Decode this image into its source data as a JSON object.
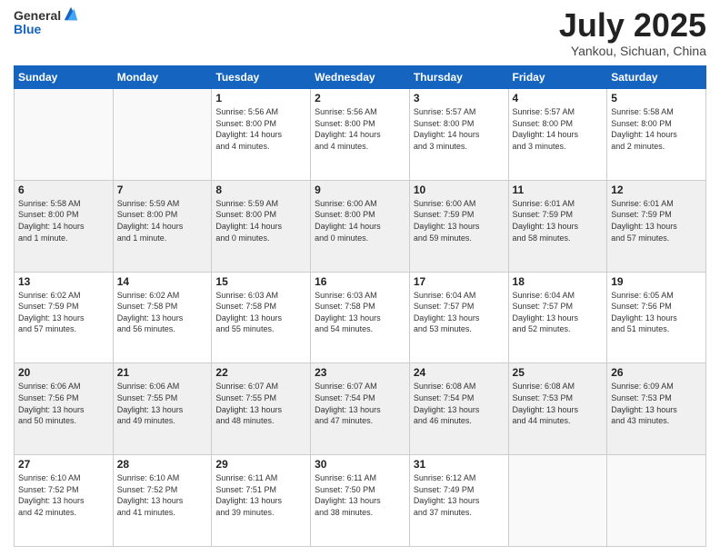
{
  "header": {
    "logo": {
      "general": "General",
      "blue": "Blue"
    },
    "title": "July 2025",
    "location": "Yankou, Sichuan, China"
  },
  "days_of_week": [
    "Sunday",
    "Monday",
    "Tuesday",
    "Wednesday",
    "Thursday",
    "Friday",
    "Saturday"
  ],
  "weeks": [
    [
      {
        "day": "",
        "info": ""
      },
      {
        "day": "",
        "info": ""
      },
      {
        "day": "1",
        "info": "Sunrise: 5:56 AM\nSunset: 8:00 PM\nDaylight: 14 hours\nand 4 minutes."
      },
      {
        "day": "2",
        "info": "Sunrise: 5:56 AM\nSunset: 8:00 PM\nDaylight: 14 hours\nand 4 minutes."
      },
      {
        "day": "3",
        "info": "Sunrise: 5:57 AM\nSunset: 8:00 PM\nDaylight: 14 hours\nand 3 minutes."
      },
      {
        "day": "4",
        "info": "Sunrise: 5:57 AM\nSunset: 8:00 PM\nDaylight: 14 hours\nand 3 minutes."
      },
      {
        "day": "5",
        "info": "Sunrise: 5:58 AM\nSunset: 8:00 PM\nDaylight: 14 hours\nand 2 minutes."
      }
    ],
    [
      {
        "day": "6",
        "info": "Sunrise: 5:58 AM\nSunset: 8:00 PM\nDaylight: 14 hours\nand 1 minute."
      },
      {
        "day": "7",
        "info": "Sunrise: 5:59 AM\nSunset: 8:00 PM\nDaylight: 14 hours\nand 1 minute."
      },
      {
        "day": "8",
        "info": "Sunrise: 5:59 AM\nSunset: 8:00 PM\nDaylight: 14 hours\nand 0 minutes."
      },
      {
        "day": "9",
        "info": "Sunrise: 6:00 AM\nSunset: 8:00 PM\nDaylight: 14 hours\nand 0 minutes."
      },
      {
        "day": "10",
        "info": "Sunrise: 6:00 AM\nSunset: 7:59 PM\nDaylight: 13 hours\nand 59 minutes."
      },
      {
        "day": "11",
        "info": "Sunrise: 6:01 AM\nSunset: 7:59 PM\nDaylight: 13 hours\nand 58 minutes."
      },
      {
        "day": "12",
        "info": "Sunrise: 6:01 AM\nSunset: 7:59 PM\nDaylight: 13 hours\nand 57 minutes."
      }
    ],
    [
      {
        "day": "13",
        "info": "Sunrise: 6:02 AM\nSunset: 7:59 PM\nDaylight: 13 hours\nand 57 minutes."
      },
      {
        "day": "14",
        "info": "Sunrise: 6:02 AM\nSunset: 7:58 PM\nDaylight: 13 hours\nand 56 minutes."
      },
      {
        "day": "15",
        "info": "Sunrise: 6:03 AM\nSunset: 7:58 PM\nDaylight: 13 hours\nand 55 minutes."
      },
      {
        "day": "16",
        "info": "Sunrise: 6:03 AM\nSunset: 7:58 PM\nDaylight: 13 hours\nand 54 minutes."
      },
      {
        "day": "17",
        "info": "Sunrise: 6:04 AM\nSunset: 7:57 PM\nDaylight: 13 hours\nand 53 minutes."
      },
      {
        "day": "18",
        "info": "Sunrise: 6:04 AM\nSunset: 7:57 PM\nDaylight: 13 hours\nand 52 minutes."
      },
      {
        "day": "19",
        "info": "Sunrise: 6:05 AM\nSunset: 7:56 PM\nDaylight: 13 hours\nand 51 minutes."
      }
    ],
    [
      {
        "day": "20",
        "info": "Sunrise: 6:06 AM\nSunset: 7:56 PM\nDaylight: 13 hours\nand 50 minutes."
      },
      {
        "day": "21",
        "info": "Sunrise: 6:06 AM\nSunset: 7:55 PM\nDaylight: 13 hours\nand 49 minutes."
      },
      {
        "day": "22",
        "info": "Sunrise: 6:07 AM\nSunset: 7:55 PM\nDaylight: 13 hours\nand 48 minutes."
      },
      {
        "day": "23",
        "info": "Sunrise: 6:07 AM\nSunset: 7:54 PM\nDaylight: 13 hours\nand 47 minutes."
      },
      {
        "day": "24",
        "info": "Sunrise: 6:08 AM\nSunset: 7:54 PM\nDaylight: 13 hours\nand 46 minutes."
      },
      {
        "day": "25",
        "info": "Sunrise: 6:08 AM\nSunset: 7:53 PM\nDaylight: 13 hours\nand 44 minutes."
      },
      {
        "day": "26",
        "info": "Sunrise: 6:09 AM\nSunset: 7:53 PM\nDaylight: 13 hours\nand 43 minutes."
      }
    ],
    [
      {
        "day": "27",
        "info": "Sunrise: 6:10 AM\nSunset: 7:52 PM\nDaylight: 13 hours\nand 42 minutes."
      },
      {
        "day": "28",
        "info": "Sunrise: 6:10 AM\nSunset: 7:52 PM\nDaylight: 13 hours\nand 41 minutes."
      },
      {
        "day": "29",
        "info": "Sunrise: 6:11 AM\nSunset: 7:51 PM\nDaylight: 13 hours\nand 39 minutes."
      },
      {
        "day": "30",
        "info": "Sunrise: 6:11 AM\nSunset: 7:50 PM\nDaylight: 13 hours\nand 38 minutes."
      },
      {
        "day": "31",
        "info": "Sunrise: 6:12 AM\nSunset: 7:49 PM\nDaylight: 13 hours\nand 37 minutes."
      },
      {
        "day": "",
        "info": ""
      },
      {
        "day": "",
        "info": ""
      }
    ]
  ]
}
